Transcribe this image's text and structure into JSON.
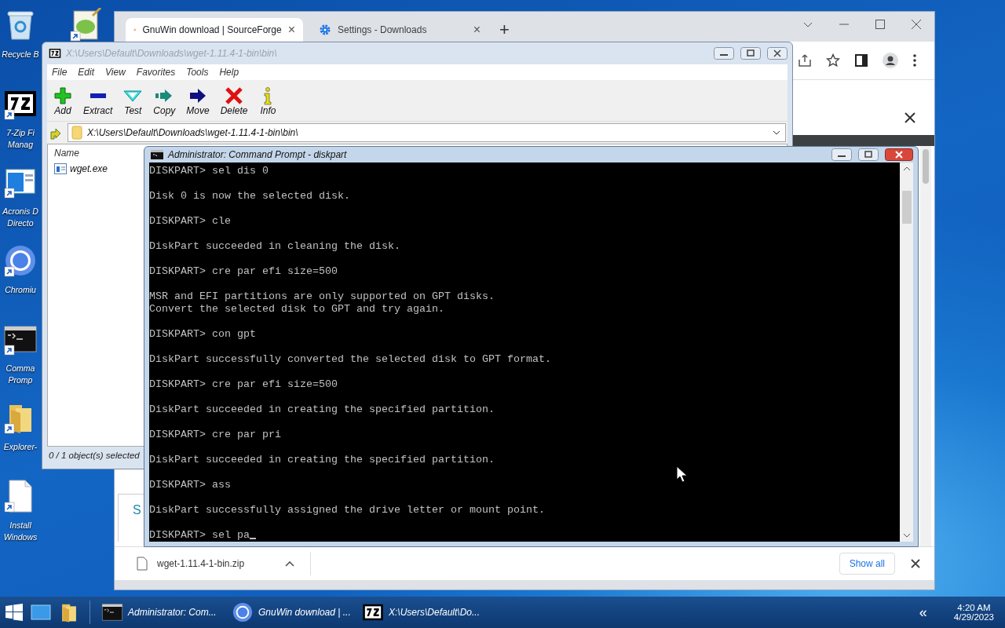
{
  "desktop": {
    "icons": [
      {
        "kind": "recycle",
        "shortcut": false,
        "label": [
          "Recycle B"
        ]
      },
      {
        "kind": "sevenzip",
        "shortcut": true,
        "label": [
          "7-Zip Fi",
          "Manag"
        ]
      },
      {
        "kind": "acronis",
        "shortcut": true,
        "label": [
          "Acronis D",
          "Directo"
        ]
      },
      {
        "kind": "chromium",
        "shortcut": true,
        "label": [
          "Chromiu"
        ]
      },
      {
        "kind": "cmd",
        "shortcut": true,
        "label": [
          "Comma",
          "Promp"
        ]
      },
      {
        "kind": "folder",
        "shortcut": true,
        "label": [
          "Explorer-"
        ]
      },
      {
        "kind": "document",
        "shortcut": true,
        "label": [
          "Install",
          "Windows"
        ]
      }
    ],
    "extra_icon": {
      "kind": "notepad",
      "shortcut": true
    }
  },
  "browser": {
    "tabs": [
      {
        "title": "GnuWin download | SourceForge",
        "kind": "sourceforge",
        "close": "×",
        "selected": true
      },
      {
        "title": "Settings - Downloads",
        "kind": "settings",
        "close": "×",
        "selected": false
      }
    ],
    "new_tab": "+",
    "page_fragment": "S",
    "download": {
      "file": "wget-1.11.4-1-bin.zip",
      "show_all": "Show all"
    }
  },
  "archiver": {
    "title": "X:\\Users\\Default\\Downloads\\wget-1.11.4-1-bin\\bin\\",
    "menu": [
      "File",
      "Edit",
      "View",
      "Favorites",
      "Tools",
      "Help"
    ],
    "toolbar": [
      {
        "kind": "add",
        "label": "Add"
      },
      {
        "kind": "extract",
        "label": "Extract"
      },
      {
        "kind": "test",
        "label": "Test"
      },
      {
        "kind": "copy",
        "label": "Copy"
      },
      {
        "kind": "move",
        "label": "Move"
      },
      {
        "kind": "delete",
        "label": "Delete"
      },
      {
        "kind": "info",
        "label": "Info"
      }
    ],
    "path": "X:\\Users\\Default\\Downloads\\wget-1.11.4-1-bin\\bin\\",
    "column": "Name",
    "files": [
      "wget.exe"
    ],
    "status": "0 / 1 object(s) selected"
  },
  "console": {
    "title": "Administrator: Command Prompt - diskpart",
    "cursor_visible": true,
    "blocks": [
      {
        "lines": [
          "DISKPART> sel dis 0"
        ]
      },
      {
        "lines": [
          "Disk 0 is now the selected disk."
        ]
      },
      {
        "lines": [
          "DISKPART> cle"
        ]
      },
      {
        "lines": [
          "DiskPart succeeded in cleaning the disk."
        ]
      },
      {
        "lines": [
          "DISKPART> cre par efi size=500"
        ]
      },
      {
        "lines": [
          "MSR and EFI partitions are only supported on GPT disks.",
          "Convert the selected disk to GPT and try again."
        ]
      },
      {
        "lines": [
          "DISKPART> con gpt"
        ]
      },
      {
        "lines": [
          "DiskPart successfully converted the selected disk to GPT format."
        ]
      },
      {
        "lines": [
          "DISKPART> cre par efi size=500"
        ]
      },
      {
        "lines": [
          "DiskPart succeeded in creating the specified partition."
        ]
      },
      {
        "lines": [
          "DISKPART> cre par pri"
        ]
      },
      {
        "lines": [
          "DiskPart succeeded in creating the specified partition."
        ]
      },
      {
        "lines": [
          "DISKPART> ass"
        ]
      },
      {
        "lines": [
          "DiskPart successfully assigned the drive letter or mount point."
        ]
      },
      {
        "lines": [
          "DISKPART> sel pa"
        ]
      }
    ]
  },
  "taskbar": {
    "tasks": [
      {
        "kind": "cmd",
        "label": "Administrator: Com..."
      },
      {
        "kind": "chromium",
        "label": "GnuWin download | ..."
      },
      {
        "kind": "sevenzip",
        "label": "X:\\Users\\Default\\Do..."
      }
    ],
    "overflow": "«",
    "time": "4:20 AM",
    "date": "4/29/2023"
  }
}
